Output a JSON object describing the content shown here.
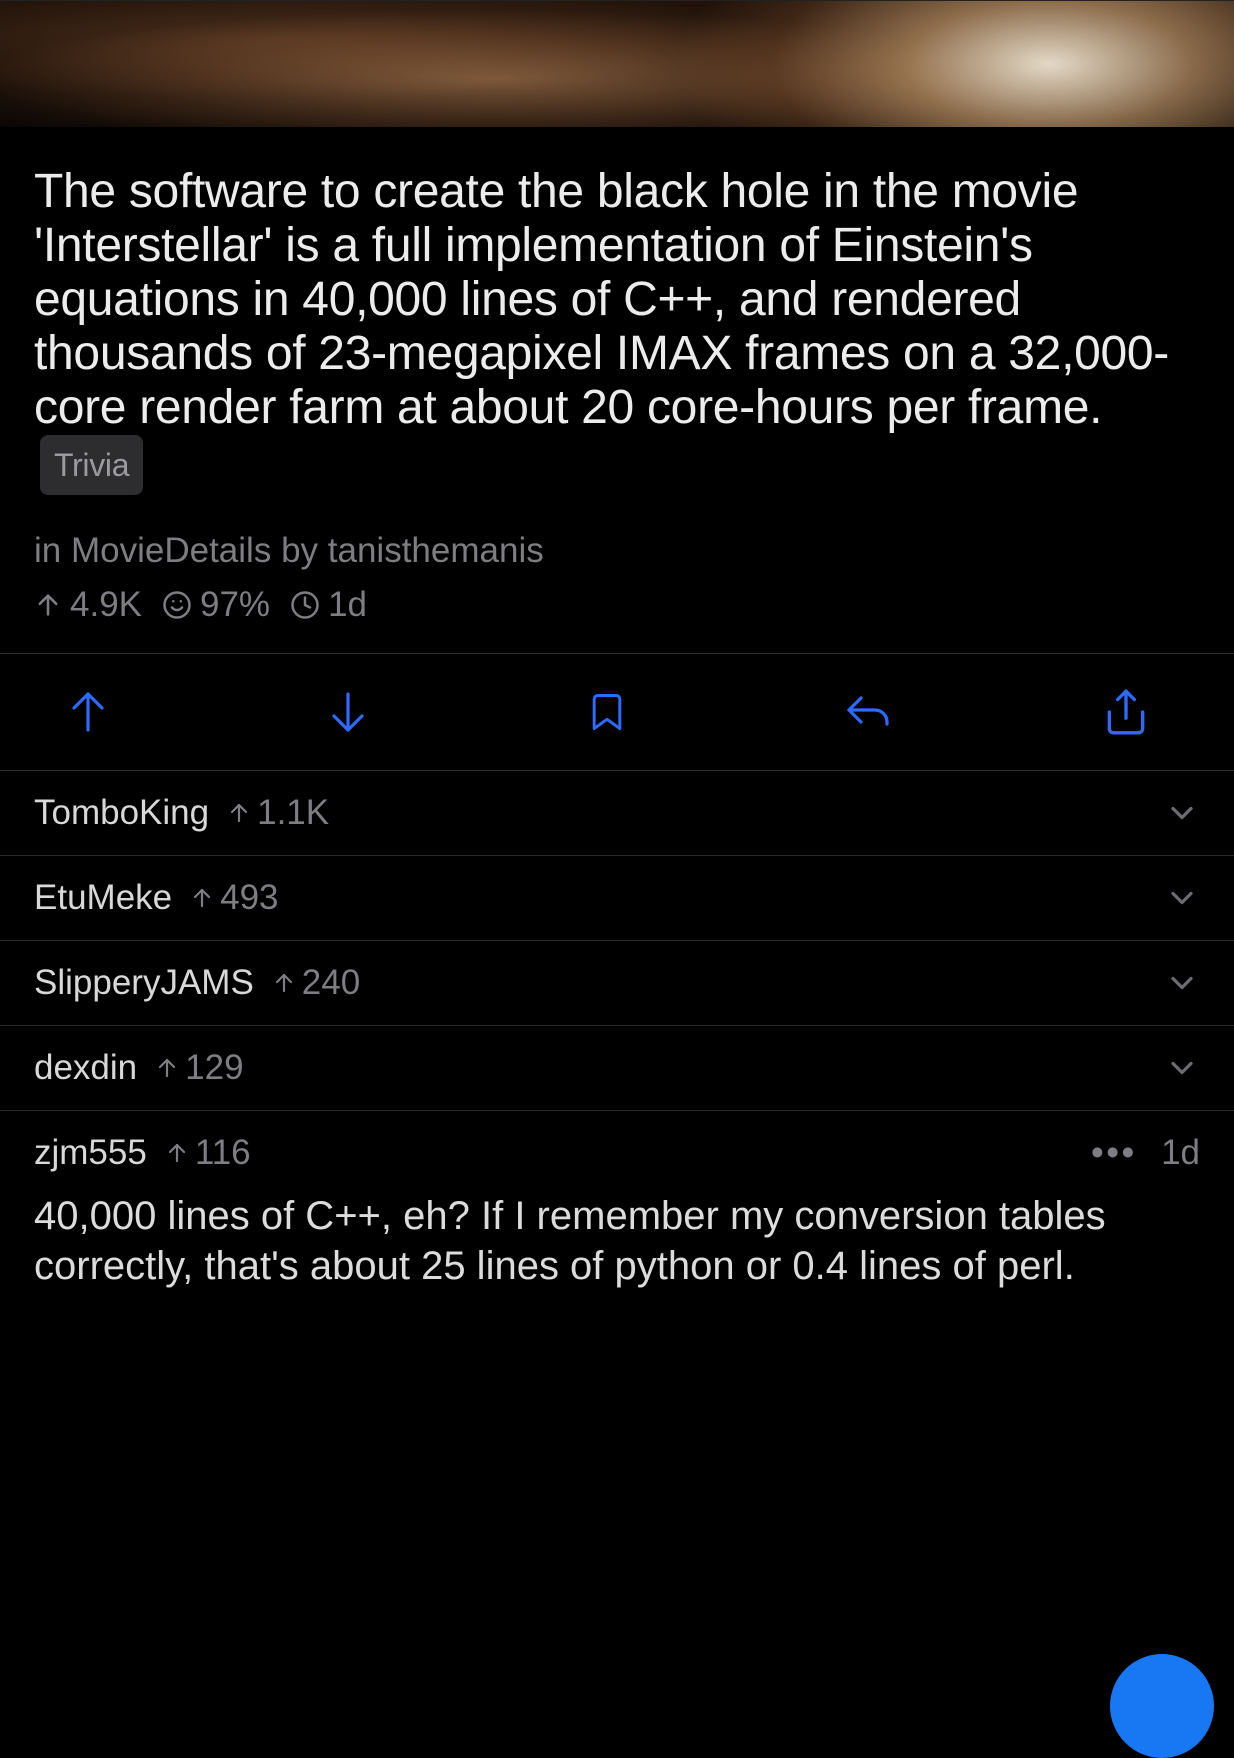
{
  "post": {
    "title": "The software to create the black hole in the movie 'Interstellar' is a full implementation of Einstein's equations in 40,000 lines of C++, and rendered thousands of 23-megapixel IMAX frames on a 32,000-core render farm at about 20 core-hours per frame.",
    "tag": "Trivia",
    "subreddit_prefix": "in",
    "subreddit": "MovieDetails",
    "author_prefix": "by",
    "author": "tanisthemanis",
    "upvotes": "4.9K",
    "upvote_ratio": "97%",
    "age": "1d"
  },
  "collapsed_comments": [
    {
      "user": "TomboKing",
      "score": "1.1K"
    },
    {
      "user": "EtuMeke",
      "score": "493"
    },
    {
      "user": "SlipperyJAMS",
      "score": "240"
    },
    {
      "user": "dexdin",
      "score": "129"
    }
  ],
  "expanded_comment": {
    "user": "zjm555",
    "score": "116",
    "age": "1d",
    "body": "40,000 lines of C++, eh? If I remember my conversion tables correctly, that's about 25 lines of python or 0.4 lines of perl."
  }
}
